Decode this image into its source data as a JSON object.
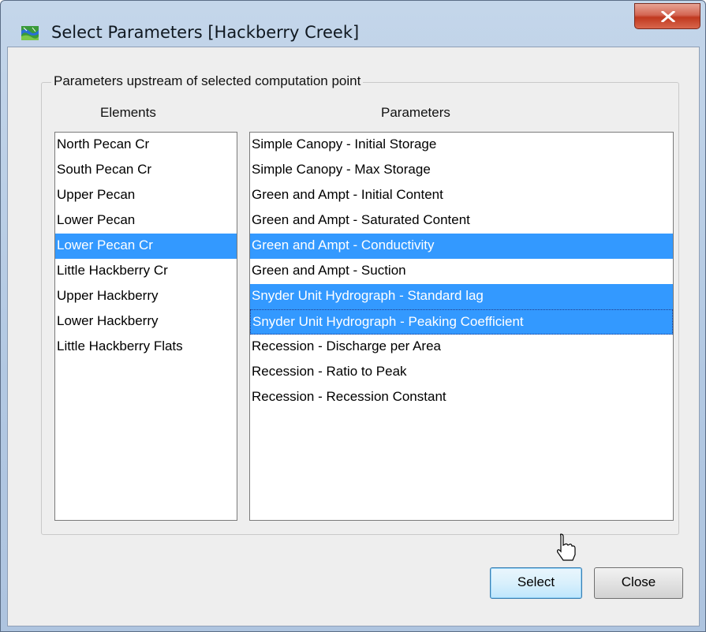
{
  "window": {
    "title": "Select Parameters [Hackberry Creek]",
    "icon": "watershed-app-icon",
    "close_icon": "close-icon"
  },
  "group": {
    "label": "Parameters upstream of selected computation point"
  },
  "elements": {
    "header": "Elements",
    "items": [
      {
        "label": "North Pecan Cr",
        "selected": false
      },
      {
        "label": "South Pecan Cr",
        "selected": false
      },
      {
        "label": "Upper Pecan",
        "selected": false
      },
      {
        "label": "Lower Pecan",
        "selected": false
      },
      {
        "label": "Lower Pecan Cr",
        "selected": true
      },
      {
        "label": "Little Hackberry Cr",
        "selected": false
      },
      {
        "label": "Upper Hackberry",
        "selected": false
      },
      {
        "label": "Lower Hackberry",
        "selected": false
      },
      {
        "label": "Little Hackberry Flats",
        "selected": false
      }
    ]
  },
  "parameters": {
    "header": "Parameters",
    "items": [
      {
        "label": "Simple Canopy - Initial Storage",
        "selected": false
      },
      {
        "label": "Simple Canopy - Max Storage",
        "selected": false
      },
      {
        "label": "Green and Ampt - Initial Content",
        "selected": false
      },
      {
        "label": "Green and Ampt - Saturated Content",
        "selected": false
      },
      {
        "label": "Green and Ampt - Conductivity",
        "selected": true
      },
      {
        "label": "Green and Ampt - Suction",
        "selected": false
      },
      {
        "label": "Snyder Unit Hydrograph - Standard lag",
        "selected": true
      },
      {
        "label": "Snyder Unit Hydrograph - Peaking Coefficient",
        "selected": true,
        "focused": true
      },
      {
        "label": "Recession - Discharge per Area",
        "selected": false
      },
      {
        "label": "Recession - Ratio to Peak",
        "selected": false
      },
      {
        "label": "Recession - Recession Constant",
        "selected": false
      }
    ]
  },
  "buttons": {
    "select_label": "Select",
    "close_label": "Close"
  },
  "colors": {
    "selection": "#3399ff",
    "title_bar": "#b9cde5",
    "close_button": "#c94a33"
  }
}
